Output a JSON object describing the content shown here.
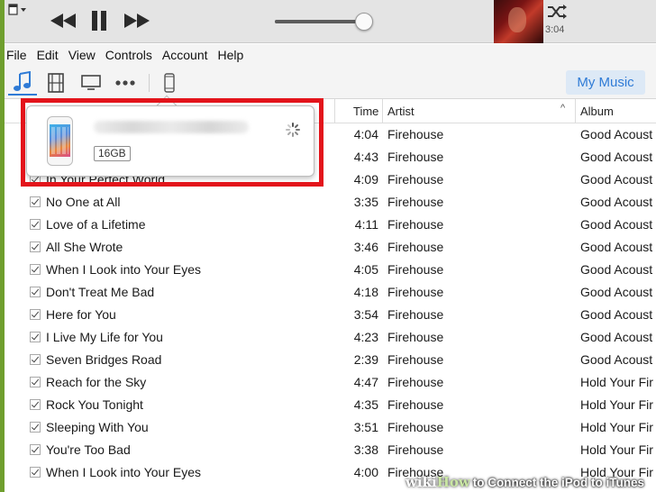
{
  "menubar": {
    "items": [
      "File",
      "Edit",
      "View",
      "Controls",
      "Account",
      "Help"
    ]
  },
  "player": {
    "time": "3:04",
    "volume_level": 0.9
  },
  "sourcebar": {
    "my_music_label": "My Music"
  },
  "song_list": {
    "columns": {
      "time": "Time",
      "artist": "Artist",
      "album": "Album",
      "sort_indicator": "^"
    },
    "rows": [
      {
        "name": "",
        "time": "4:04",
        "artist": "Firehouse",
        "album": "Good Acoust"
      },
      {
        "name": "",
        "time": "4:43",
        "artist": "Firehouse",
        "album": "Good Acoust"
      },
      {
        "name": "In Your Perfect World",
        "time": "4:09",
        "artist": "Firehouse",
        "album": "Good Acoust"
      },
      {
        "name": "No One at All",
        "time": "3:35",
        "artist": "Firehouse",
        "album": "Good Acoust"
      },
      {
        "name": "Love of a Lifetime",
        "time": "4:11",
        "artist": "Firehouse",
        "album": "Good Acoust"
      },
      {
        "name": "All She Wrote",
        "time": "3:46",
        "artist": "Firehouse",
        "album": "Good Acoust"
      },
      {
        "name": "When I Look into Your Eyes",
        "time": "4:05",
        "artist": "Firehouse",
        "album": "Good Acoust"
      },
      {
        "name": "Don't Treat Me Bad",
        "time": "4:18",
        "artist": "Firehouse",
        "album": "Good Acoust"
      },
      {
        "name": "Here for You",
        "time": "3:54",
        "artist": "Firehouse",
        "album": "Good Acoust"
      },
      {
        "name": "I Live My Life for You",
        "time": "4:23",
        "artist": "Firehouse",
        "album": "Good Acoust"
      },
      {
        "name": "Seven Bridges Road",
        "time": "2:39",
        "artist": "Firehouse",
        "album": "Good Acoust"
      },
      {
        "name": "Reach for the Sky",
        "time": "4:47",
        "artist": "Firehouse",
        "album": "Hold Your Fir"
      },
      {
        "name": "Rock You Tonight",
        "time": "4:35",
        "artist": "Firehouse",
        "album": "Hold Your Fir"
      },
      {
        "name": "Sleeping With You",
        "time": "3:51",
        "artist": "Firehouse",
        "album": "Hold Your Fir"
      },
      {
        "name": "You're Too Bad",
        "time": "3:38",
        "artist": "Firehouse",
        "album": "Hold Your Fir"
      },
      {
        "name": "When I Look into Your Eyes",
        "time": "4:00",
        "artist": "Firehouse",
        "album": "Hold Your Fir"
      }
    ]
  },
  "device_popover": {
    "capacity": "16GB"
  },
  "watermark": {
    "logo_prefix": "wiki",
    "logo_suffix": "How",
    "text": "to Connect the iPod to iTunes"
  },
  "colors": {
    "accent": "#2f7bd6",
    "highlight": "#e3141b",
    "frame": "#6f9f2e"
  },
  "icons": [
    "window-menu-icon",
    "previous-track-icon",
    "pause-icon",
    "next-track-icon",
    "shuffle-icon",
    "music-note-icon",
    "film-icon",
    "tv-icon",
    "more-dots-icon",
    "iphone-icon",
    "spinner-icon"
  ]
}
